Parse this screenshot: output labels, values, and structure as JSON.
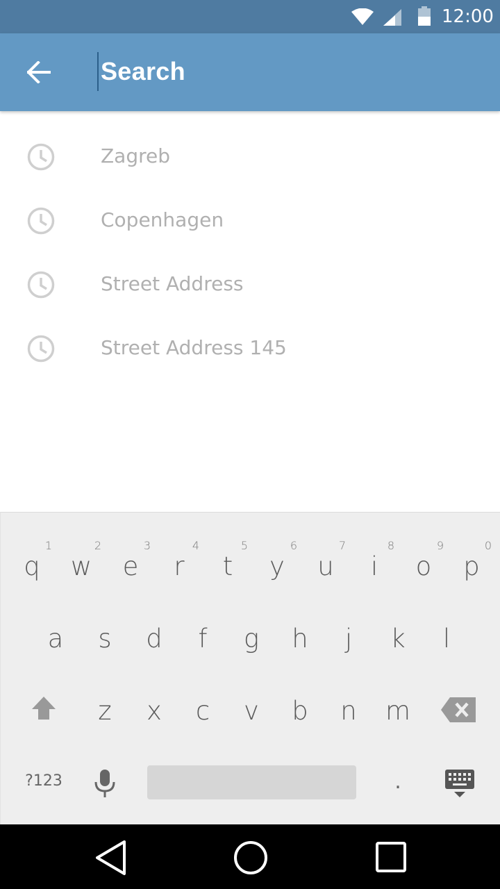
{
  "status_bar": {
    "time": "12:00",
    "icons": [
      "wifi-icon",
      "cellular-signal-icon",
      "battery-icon"
    ]
  },
  "toolbar": {
    "back_icon": "arrow-back-icon",
    "search_placeholder": "Search"
  },
  "history": {
    "icon": "clock-history-icon",
    "items": [
      {
        "label": "Zagreb"
      },
      {
        "label": "Copenhagen"
      },
      {
        "label": "Street Address"
      },
      {
        "label": "Street Address 145"
      }
    ]
  },
  "keyboard": {
    "row1": [
      {
        "key": "q",
        "hint": "1"
      },
      {
        "key": "w",
        "hint": "2"
      },
      {
        "key": "e",
        "hint": "3"
      },
      {
        "key": "r",
        "hint": "4"
      },
      {
        "key": "t",
        "hint": "5"
      },
      {
        "key": "y",
        "hint": "6"
      },
      {
        "key": "u",
        "hint": "7"
      },
      {
        "key": "i",
        "hint": "8"
      },
      {
        "key": "o",
        "hint": "9"
      },
      {
        "key": "p",
        "hint": "0"
      }
    ],
    "row2": [
      "a",
      "s",
      "d",
      "f",
      "g",
      "h",
      "j",
      "k",
      "l"
    ],
    "row3": [
      "z",
      "x",
      "c",
      "v",
      "b",
      "n",
      "m"
    ],
    "symbols_label": "?123",
    "period_label": ".",
    "icons": [
      "shift-icon",
      "backspace-icon",
      "microphone-icon",
      "keyboard-hide-icon"
    ]
  },
  "nav_bar": {
    "icons": [
      "back-triangle-icon",
      "home-circle-icon",
      "recents-square-icon"
    ]
  },
  "colors": {
    "status_bar": "#4f7ba1",
    "toolbar": "#6399c4",
    "history_text": "#b0b0b0",
    "keyboard_bg": "#eeeeee"
  }
}
